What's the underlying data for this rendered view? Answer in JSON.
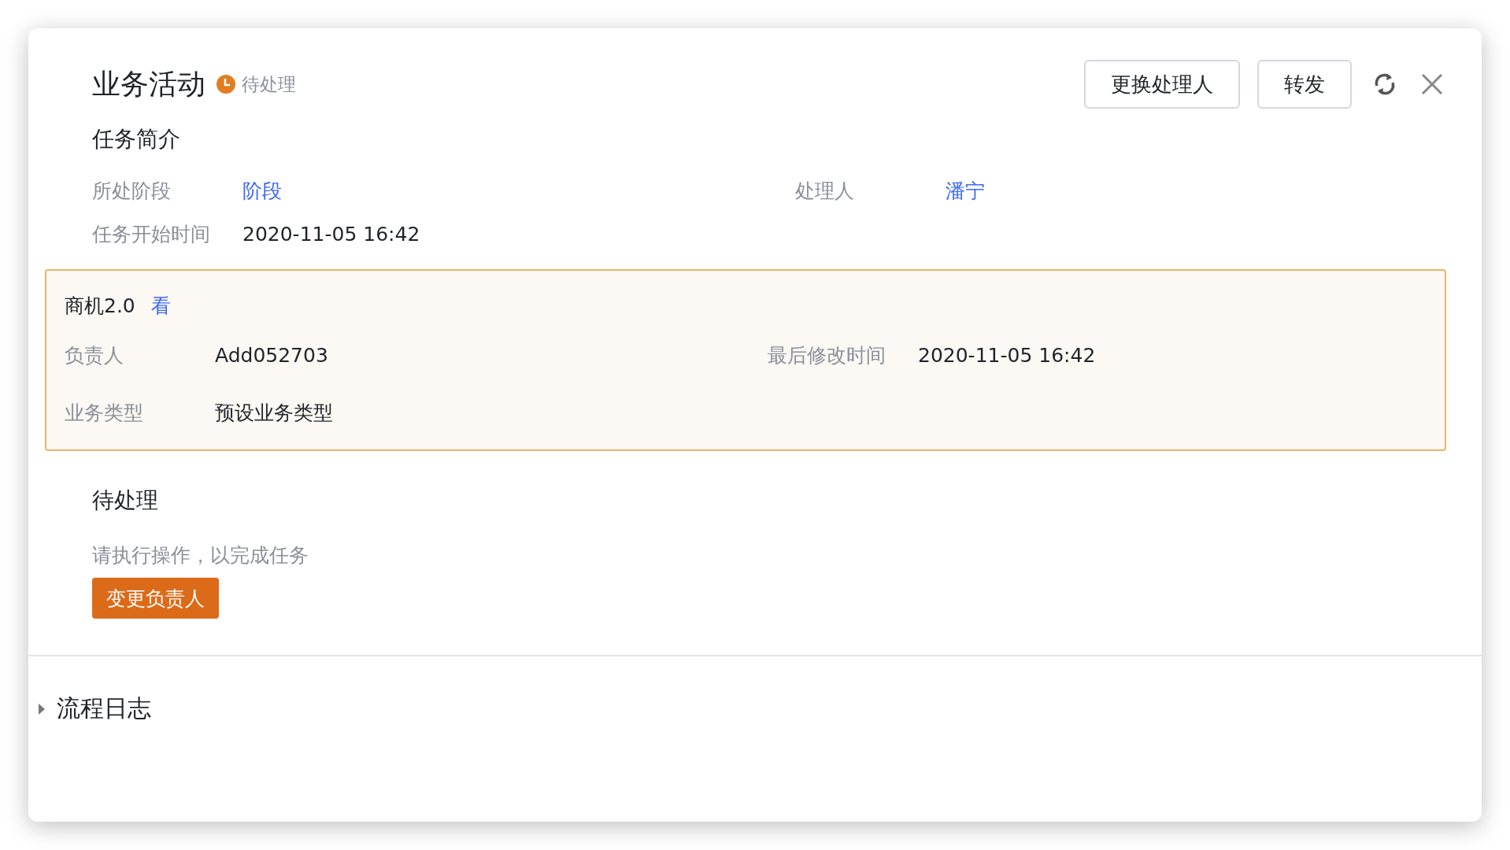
{
  "header": {
    "title": "业务活动",
    "status": "待处理"
  },
  "actions": [
    {
      "label": "更换处理人"
    },
    {
      "label": "转发"
    }
  ],
  "summary": {
    "title": "任务简介",
    "fields": [
      {
        "label": "所处阶段",
        "value": "阶段",
        "kind": "link"
      },
      {
        "label": "处理人",
        "value": "潘宁",
        "kind": "link"
      },
      {
        "label": "任务开始时间",
        "value": "2020-11-05 16:42",
        "kind": "text"
      }
    ]
  },
  "record": {
    "title": "商机2.0",
    "link": "看",
    "fields": [
      {
        "label": "负责人",
        "value": "Add052703"
      },
      {
        "label": "最后修改时间",
        "value": "2020-11-05 16:42"
      },
      {
        "label": "业务类型",
        "value": "预设业务类型"
      }
    ]
  },
  "pending": {
    "title": "待处理",
    "hint": "请执行操作，以完成任务",
    "button": "变更负责人"
  },
  "log": {
    "title": "流程日志",
    "expanded": false
  }
}
